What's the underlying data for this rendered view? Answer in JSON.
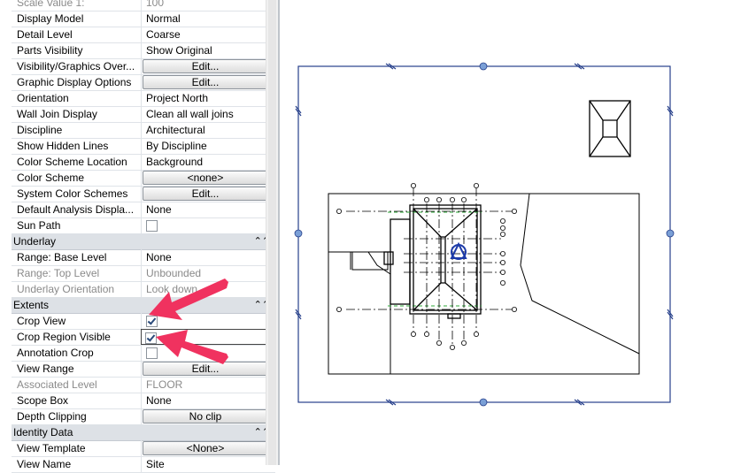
{
  "properties": {
    "rows": [
      {
        "type": "prop",
        "name": "Scale Value 1:",
        "value": "100",
        "disabled": true
      },
      {
        "type": "prop",
        "name": "Display Model",
        "value": "Normal"
      },
      {
        "type": "prop",
        "name": "Detail Level",
        "value": "Coarse"
      },
      {
        "type": "prop",
        "name": "Parts Visibility",
        "value": "Show Original"
      },
      {
        "type": "button",
        "name": "Visibility/Graphics Over...",
        "value": "Edit..."
      },
      {
        "type": "button",
        "name": "Graphic Display Options",
        "value": "Edit..."
      },
      {
        "type": "prop",
        "name": "Orientation",
        "value": "Project North"
      },
      {
        "type": "prop",
        "name": "Wall Join Display",
        "value": "Clean all wall joins"
      },
      {
        "type": "prop",
        "name": "Discipline",
        "value": "Architectural"
      },
      {
        "type": "prop",
        "name": "Show Hidden Lines",
        "value": "By Discipline"
      },
      {
        "type": "prop",
        "name": "Color Scheme Location",
        "value": "Background"
      },
      {
        "type": "button",
        "name": "Color Scheme",
        "value": "<none>"
      },
      {
        "type": "button",
        "name": "System Color Schemes",
        "value": "Edit..."
      },
      {
        "type": "prop",
        "name": "Default Analysis Displa...",
        "value": "None"
      },
      {
        "type": "check",
        "name": "Sun Path",
        "checked": false
      },
      {
        "type": "group",
        "name": "Underlay",
        "collapse": "⌃⌃"
      },
      {
        "type": "prop",
        "name": "Range: Base Level",
        "value": "None"
      },
      {
        "type": "prop",
        "name": "Range: Top Level",
        "value": "Unbounded",
        "disabled": true
      },
      {
        "type": "prop",
        "name": "Underlay Orientation",
        "value": "Look down",
        "disabled": true
      },
      {
        "type": "group",
        "name": "Extents",
        "collapse": "⌃⌃"
      },
      {
        "type": "check",
        "name": "Crop View",
        "checked": true
      },
      {
        "type": "check",
        "name": "Crop Region Visible",
        "checked": true,
        "focus": true
      },
      {
        "type": "check",
        "name": "Annotation Crop",
        "checked": false
      },
      {
        "type": "button",
        "name": "View Range",
        "value": "Edit..."
      },
      {
        "type": "prop",
        "name": "Associated Level",
        "value": "FLOOR",
        "disabled": true
      },
      {
        "type": "prop",
        "name": "Scope Box",
        "value": "None"
      },
      {
        "type": "button",
        "name": "Depth Clipping",
        "value": "No clip"
      },
      {
        "type": "group",
        "name": "Identity Data",
        "collapse": "⌃⌃"
      },
      {
        "type": "button",
        "name": "View Template",
        "value": "<None>"
      },
      {
        "type": "prop",
        "name": "View Name",
        "value": "Site"
      }
    ]
  },
  "icons": {
    "collapse": "double-chevron-up-icon",
    "checkbox": "checkmark-icon",
    "annotation_arrow": "pink-arrow-icon",
    "view_control": "compass-icon"
  },
  "colors": {
    "group_header": "#dde1e6",
    "crop_region": "#27408b",
    "grip": "#7a9fd6",
    "arrow": "#f0325f",
    "view_symbol": "#1c3aa8",
    "gridline_dash": "#2fa83a"
  }
}
